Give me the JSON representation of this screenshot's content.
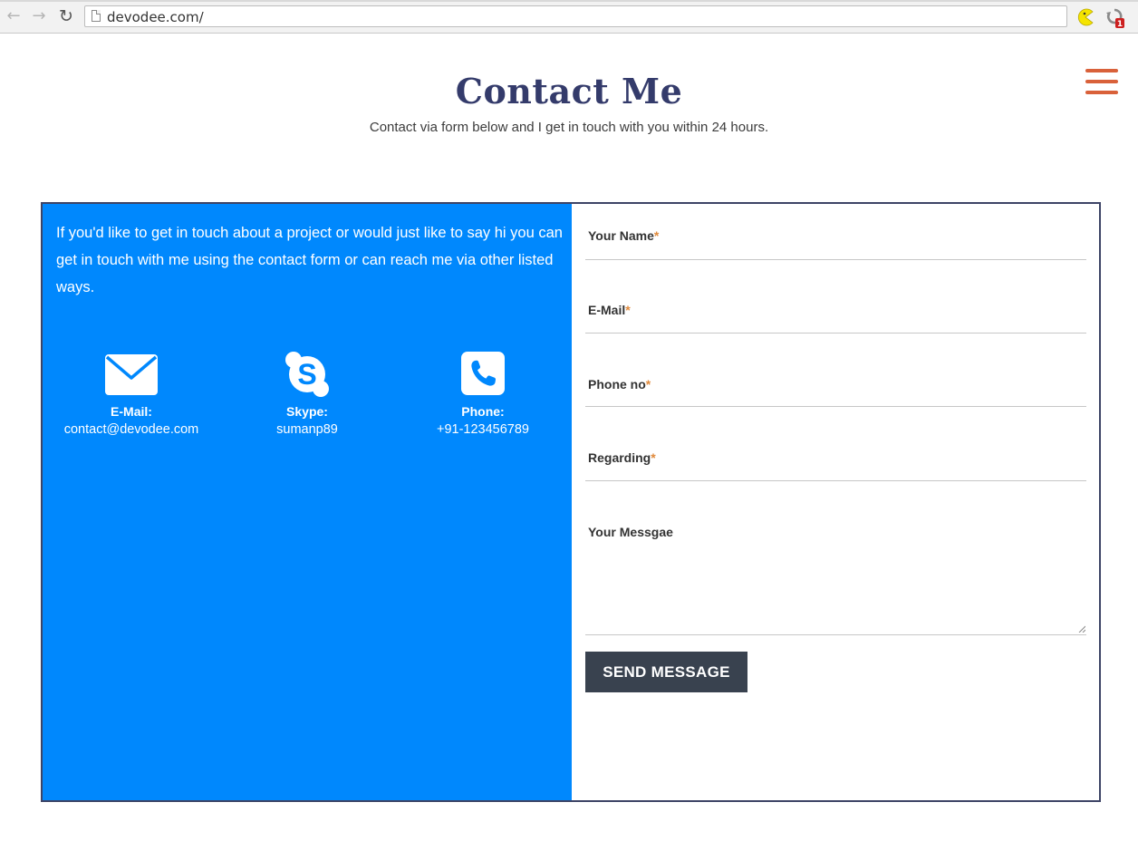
{
  "browser": {
    "url": "devodee.com/",
    "extensions": [
      "pacman-icon",
      "sync-badge-icon"
    ],
    "badge_count": "1"
  },
  "header": {
    "title": "Contact Me",
    "subtitle": "Contact via form below and I get in touch with you within 24 hours.",
    "menu_icon": "hamburger-menu-icon"
  },
  "info": {
    "intro": "If you'd like to get in touch about a project or would just like to say hi you can get in touch with me using the contact form or can reach me via other listed ways.",
    "channels": [
      {
        "icon": "envelope-icon",
        "label": "E-Mail:",
        "value": "contact@devodee.com"
      },
      {
        "icon": "skype-icon",
        "label": "Skype:",
        "value": "sumanp89"
      },
      {
        "icon": "phone-icon",
        "label": "Phone:",
        "value": "+91-123456789"
      }
    ]
  },
  "form": {
    "fields": [
      {
        "label": "Your Name",
        "required_mark": "*",
        "value": ""
      },
      {
        "label": "E-Mail",
        "required_mark": "*",
        "value": ""
      },
      {
        "label": "Phone no",
        "required_mark": "*",
        "value": ""
      },
      {
        "label": "Regarding",
        "required_mark": "*",
        "value": ""
      },
      {
        "label": "Your Messgae",
        "value": ""
      }
    ],
    "submit_label": "SEND MESSAGE"
  },
  "colors": {
    "title": "#343b6b",
    "menu_accent": "#d9613a",
    "info_panel": "#0088fd",
    "panel_border": "#3d4466",
    "button": "#39424f",
    "required_mark": "#e08a3c"
  }
}
